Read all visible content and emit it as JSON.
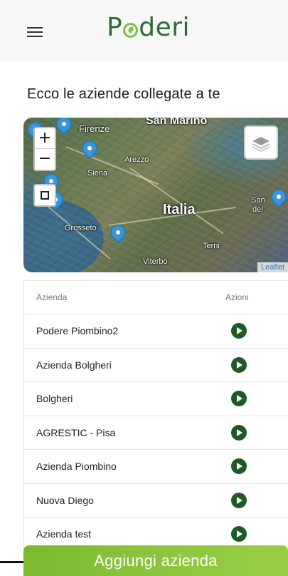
{
  "header": {
    "logo_text_prefix": "P",
    "logo_text_suffix": "deri"
  },
  "section": {
    "title": "Ecco le aziende collegate a te"
  },
  "map": {
    "zoom_in": "+",
    "zoom_out": "−",
    "attribution": "Leaflet",
    "places": {
      "san_marino": "San Marino",
      "firenze": "Firenze",
      "arezzo": "Arezzo",
      "siena": "Siena",
      "italia": "Italia",
      "grosseto": "Grosseto",
      "terni": "Terni",
      "viterbo": "Viterbo",
      "san_right_1": "San",
      "san_right_2": "del"
    }
  },
  "table": {
    "columns": [
      "Azienda",
      "Azioni"
    ],
    "rows": [
      "Podere Piombino2",
      "Azienda Bolgheri",
      "Bolgheri",
      "AGRESTIC - Pisa",
      "Azienda Piombino",
      "Nuova Diego",
      "Azienda test"
    ]
  },
  "add_button": {
    "label": "Aggiungi azienda"
  },
  "colors": {
    "brand_dark_green": "#2e6b34",
    "brand_light_green": "#7ec242",
    "action_green": "#1d5a26",
    "pin_blue": "#3b95d6"
  },
  "icons": {
    "menu": "hamburger-menu-icon",
    "layers": "layers-icon",
    "fullscreen": "fullscreen-icon",
    "action": "play-circle-icon",
    "marker": "map-marker-icon"
  }
}
